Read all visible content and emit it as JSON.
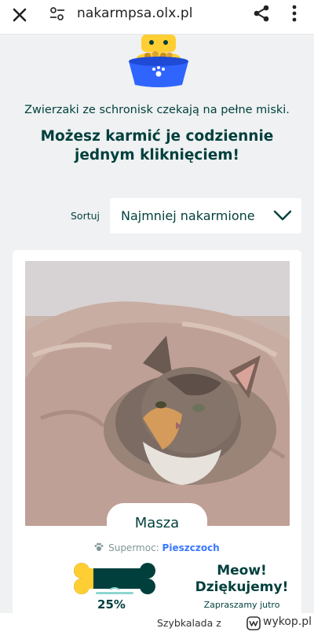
{
  "browser": {
    "url": "nakarmpsa.olx.pl",
    "icons": [
      "close-icon",
      "site-settings-icon",
      "share-icon",
      "more-vertical-icon"
    ]
  },
  "intro_text": "Zwierzaki ze schronisk czekają na pełne miski.",
  "headline_line1": "Możesz karmić je codziennie",
  "headline_line2": "jednym kliknięciem!",
  "sort": {
    "label": "Sortuj",
    "selected": "Najmniej nakarmione"
  },
  "pet_card": {
    "name": "Masza",
    "supermoc_label": "Supermoc:",
    "supermoc_value": "Pieszczoch",
    "feed_percent": "25%",
    "feed_progress": 0.25,
    "thanks_line1": "Meow!",
    "thanks_line2": "Dziękujemy!",
    "invite": "Zapraszamy jutro"
  },
  "watermark": {
    "user": "Szybkalada",
    "separator": "z",
    "site": "wykop.pl"
  },
  "colors": {
    "brand_dark": "#003f3c",
    "accent_blue": "#3a77ff",
    "bone_yellow": "#ffce32",
    "bone_dark": "#003f3c",
    "page_bg": "#eff1f2"
  }
}
